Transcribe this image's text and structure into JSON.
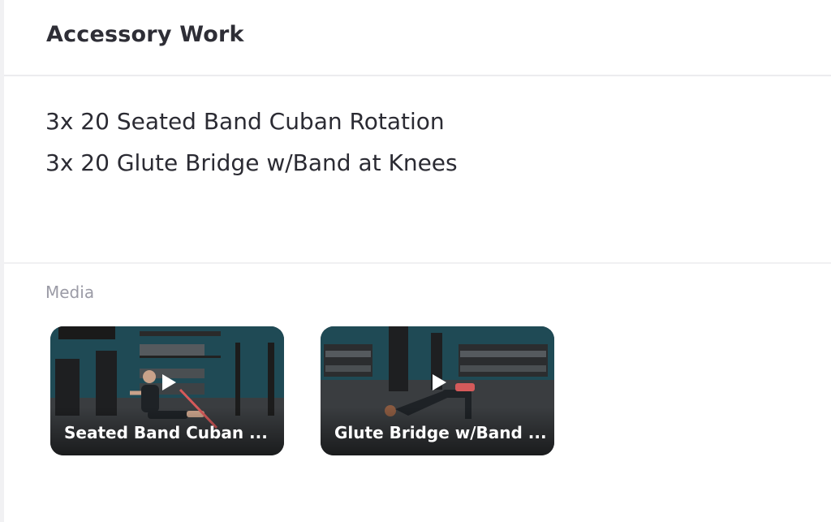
{
  "section": {
    "title": "Accessory Work"
  },
  "exercises": [
    "3x 20 Seated Band Cuban Rotation",
    "3x 20 Glute Bridge w/Band at Knees"
  ],
  "media": {
    "label": "Media",
    "videos": [
      {
        "caption": "Seated Band Cuban ..."
      },
      {
        "caption": "Glute Bridge w/Band ..."
      }
    ]
  },
  "colors": {
    "title_text": "#2e2e36",
    "body_text": "#2b2b33",
    "muted_label": "#9b9ba6",
    "gym_wall": "#1f4a55",
    "gym_floor": "#3a3d40",
    "band": "#d65a5a"
  },
  "icons": {
    "play": "play-icon"
  }
}
